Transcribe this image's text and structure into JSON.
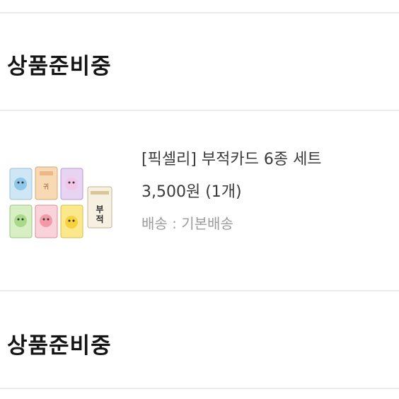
{
  "sections": [
    {
      "status": "상품준비중"
    },
    {
      "status": "상품준비중"
    }
  ],
  "product": {
    "name": "[픽셀리] 부적카드 6종 세트",
    "price_line": "3,500원 (1개)",
    "shipping_line": "배송 : 기본배송",
    "thumbnail_text": "부적",
    "thumbnail_card_colors": [
      "#cfe6f5",
      "#f7d9b4",
      "#e7d3f2",
      "#d8efc4",
      "#f9d3d9",
      "#fbe78c"
    ]
  }
}
